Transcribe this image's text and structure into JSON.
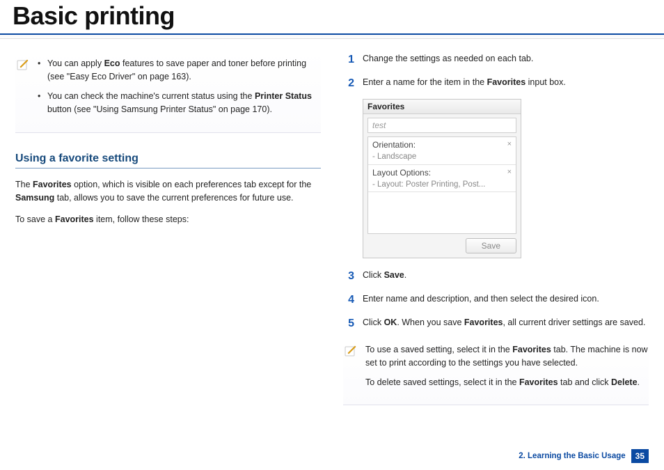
{
  "page": {
    "title": "Basic printing",
    "chapter_label": "2. Learning the Basic Usage",
    "page_number": "35"
  },
  "left": {
    "note1_line1_a": "You can apply ",
    "note1_line1_b": "Eco",
    "note1_line1_c": " features to save paper and toner before printing (see \"Easy Eco Driver\" on page 163).",
    "note1_line2_a": "You can check the machine's current status using the ",
    "note1_line2_b": "Printer Status",
    "note1_line2_c": " button (see \"Using Samsung Printer Status\" on page 170).",
    "section_heading": "Using a favorite setting",
    "para1_a": "The ",
    "para1_b": "Favorites",
    "para1_c": " option, which is visible on each preferences tab except for the ",
    "para1_d": "Samsung",
    "para1_e": " tab, allows you to save the current preferences for future use.",
    "para2_a": "To save a ",
    "para2_b": "Favorites",
    "para2_c": " item, follow these steps:"
  },
  "right": {
    "step1": "Change the settings as needed on each tab.",
    "step2_a": "Enter a name for the item in the ",
    "step2_b": "Favorites",
    "step2_c": " input box.",
    "step3_a": "Click ",
    "step3_b": "Save",
    "step3_c": ".",
    "step4": "Enter name and description, and then select the desired icon.",
    "step5_a": "Click ",
    "step5_b": "OK",
    "step5_c": ". When you save ",
    "step5_d": "Favorites",
    "step5_e": ", all current driver settings are saved.",
    "note2_p1_a": "To use a saved setting, select it in the ",
    "note2_p1_b": "Favorites",
    "note2_p1_c": " tab. The machine is now set to print according to the settings you have selected.",
    "note2_p2_a": "To delete saved settings, select it in the ",
    "note2_p2_b": "Favorites",
    "note2_p2_c": " tab and click ",
    "note2_p2_d": "Delete",
    "note2_p2_e": "."
  },
  "panel": {
    "title": "Favorites",
    "input_value": "test",
    "row1_label": "Orientation:",
    "row1_sub": "- Landscape",
    "row2_label": "Layout Options:",
    "row2_sub": "- Layout: Poster Printing, Post...",
    "close_glyph": "×",
    "save_label": "Save"
  },
  "nums": {
    "n1": "1",
    "n2": "2",
    "n3": "3",
    "n4": "4",
    "n5": "5"
  }
}
